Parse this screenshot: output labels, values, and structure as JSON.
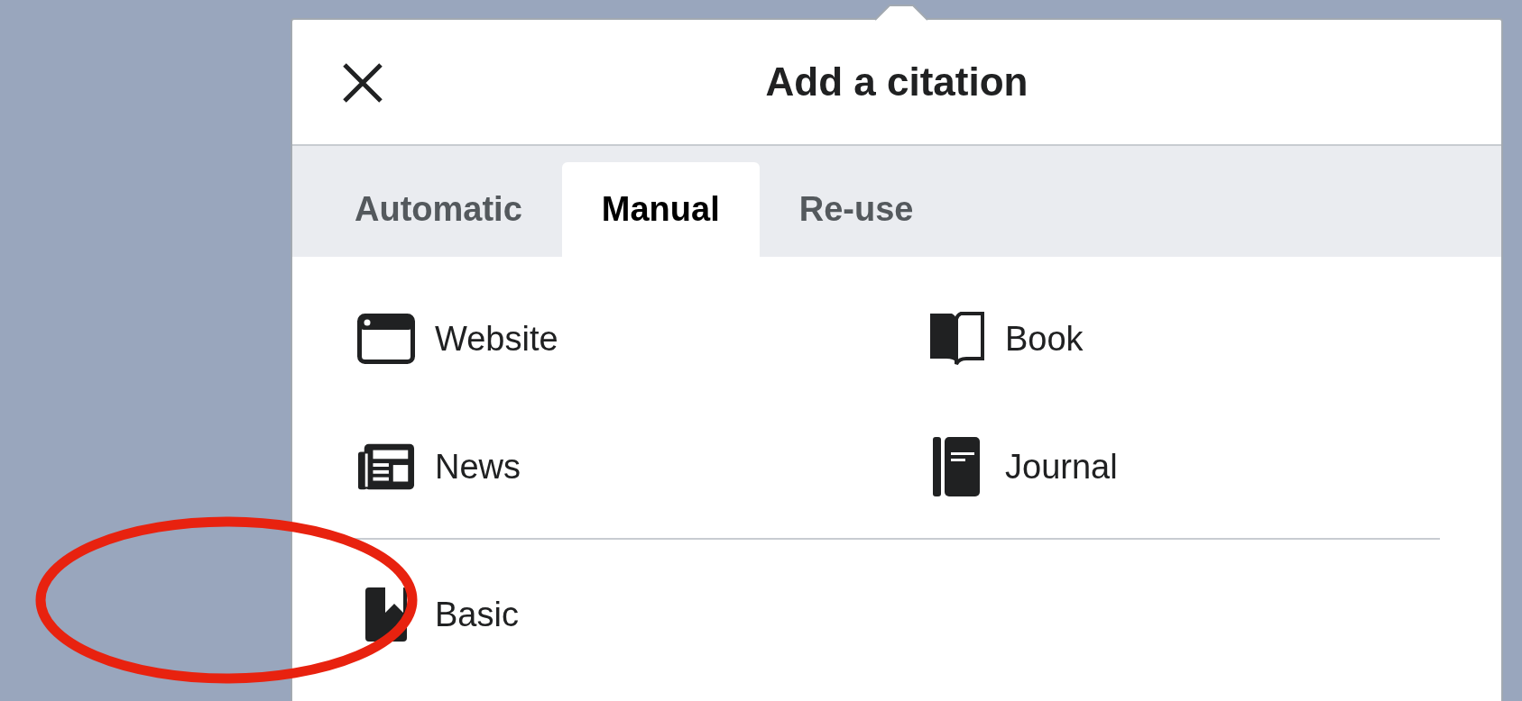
{
  "dialog": {
    "title": "Add a citation"
  },
  "tabs": [
    {
      "label": "Automatic",
      "selected": false
    },
    {
      "label": "Manual",
      "selected": true
    },
    {
      "label": "Re-use",
      "selected": false
    }
  ],
  "sections": [
    {
      "items": [
        {
          "kind": "website",
          "label": "Website"
        },
        {
          "kind": "book",
          "label": "Book"
        },
        {
          "kind": "news",
          "label": "News"
        },
        {
          "kind": "journal",
          "label": "Journal"
        }
      ]
    },
    {
      "items": [
        {
          "kind": "basic",
          "label": "Basic"
        }
      ]
    }
  ]
}
